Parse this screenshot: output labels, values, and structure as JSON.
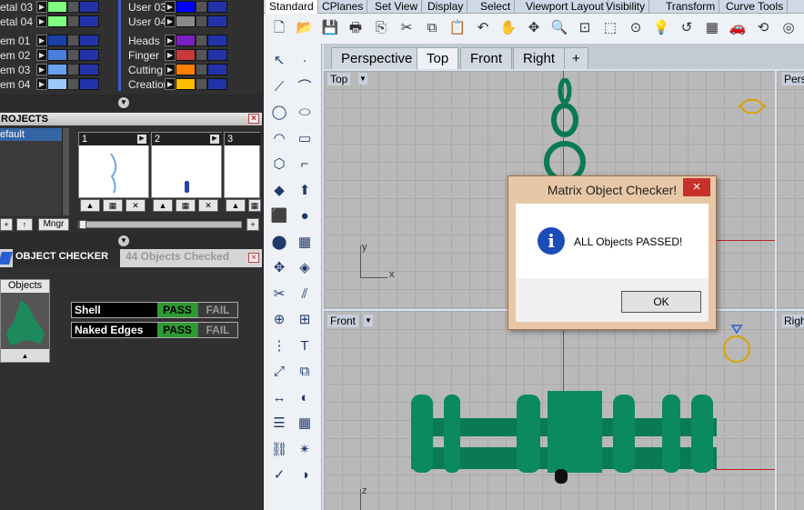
{
  "layers": {
    "left_col": [
      {
        "name": "etal 03",
        "color": "#7fff7f"
      },
      {
        "name": "etal 04",
        "color": "#7fff7f"
      },
      {
        "name": "em 01",
        "color": "#1a3fa8"
      },
      {
        "name": "em 02",
        "color": "#4a7fe0"
      },
      {
        "name": "em 03",
        "color": "#6aa0f0"
      },
      {
        "name": "em 04",
        "color": "#9cc8f8"
      }
    ],
    "right_col": [
      {
        "name": "User 03",
        "color": "#0000ff"
      },
      {
        "name": "User 04",
        "color": "#8a8a8a"
      },
      {
        "name": "Heads",
        "color": "#7a1fbf"
      },
      {
        "name": "Finger",
        "color": "#c83a3a"
      },
      {
        "name": "Cutting",
        "color": "#ff7f00"
      },
      {
        "name": "Creation",
        "color": "#ffbf00"
      }
    ]
  },
  "projects": {
    "title": "ROJECTS",
    "list_item": "efault",
    "thumbs": [
      "1",
      "2",
      "3"
    ],
    "mngr_label": "Mngr",
    "add_label": "+"
  },
  "object_checker": {
    "title": "OBJECT CHECKER",
    "count_text": "44  Objects Checked",
    "objects_tab": "Objects",
    "rows": [
      {
        "label": "Shell",
        "pass": "PASS",
        "fail": "FAIL"
      },
      {
        "label": "Naked Edges",
        "pass": "PASS",
        "fail": "FAIL"
      }
    ]
  },
  "toolbar_tabs": [
    "Standard",
    "CPlanes",
    "Set View",
    "Display",
    "Select",
    "Viewport Layout",
    "Visibility",
    "Transform",
    "Curve Tools"
  ],
  "viewport_tabs": [
    "Perspective",
    "Top",
    "Front",
    "Right",
    "+"
  ],
  "viewports": {
    "top_label": "Top",
    "front_label": "Front",
    "persp_label": "Pers",
    "right_label": "Righ",
    "axis_y": "y",
    "axis_x": "x",
    "axis_z": "z"
  },
  "dialog": {
    "title": "Matrix Object Checker!",
    "message": "ALL Objects PASSED!",
    "ok": "OK",
    "close": "×"
  },
  "colors": {
    "accent_green": "#0a7a55",
    "pass_green": "#2e9a34",
    "dialog_bg": "#e8c7a7"
  }
}
